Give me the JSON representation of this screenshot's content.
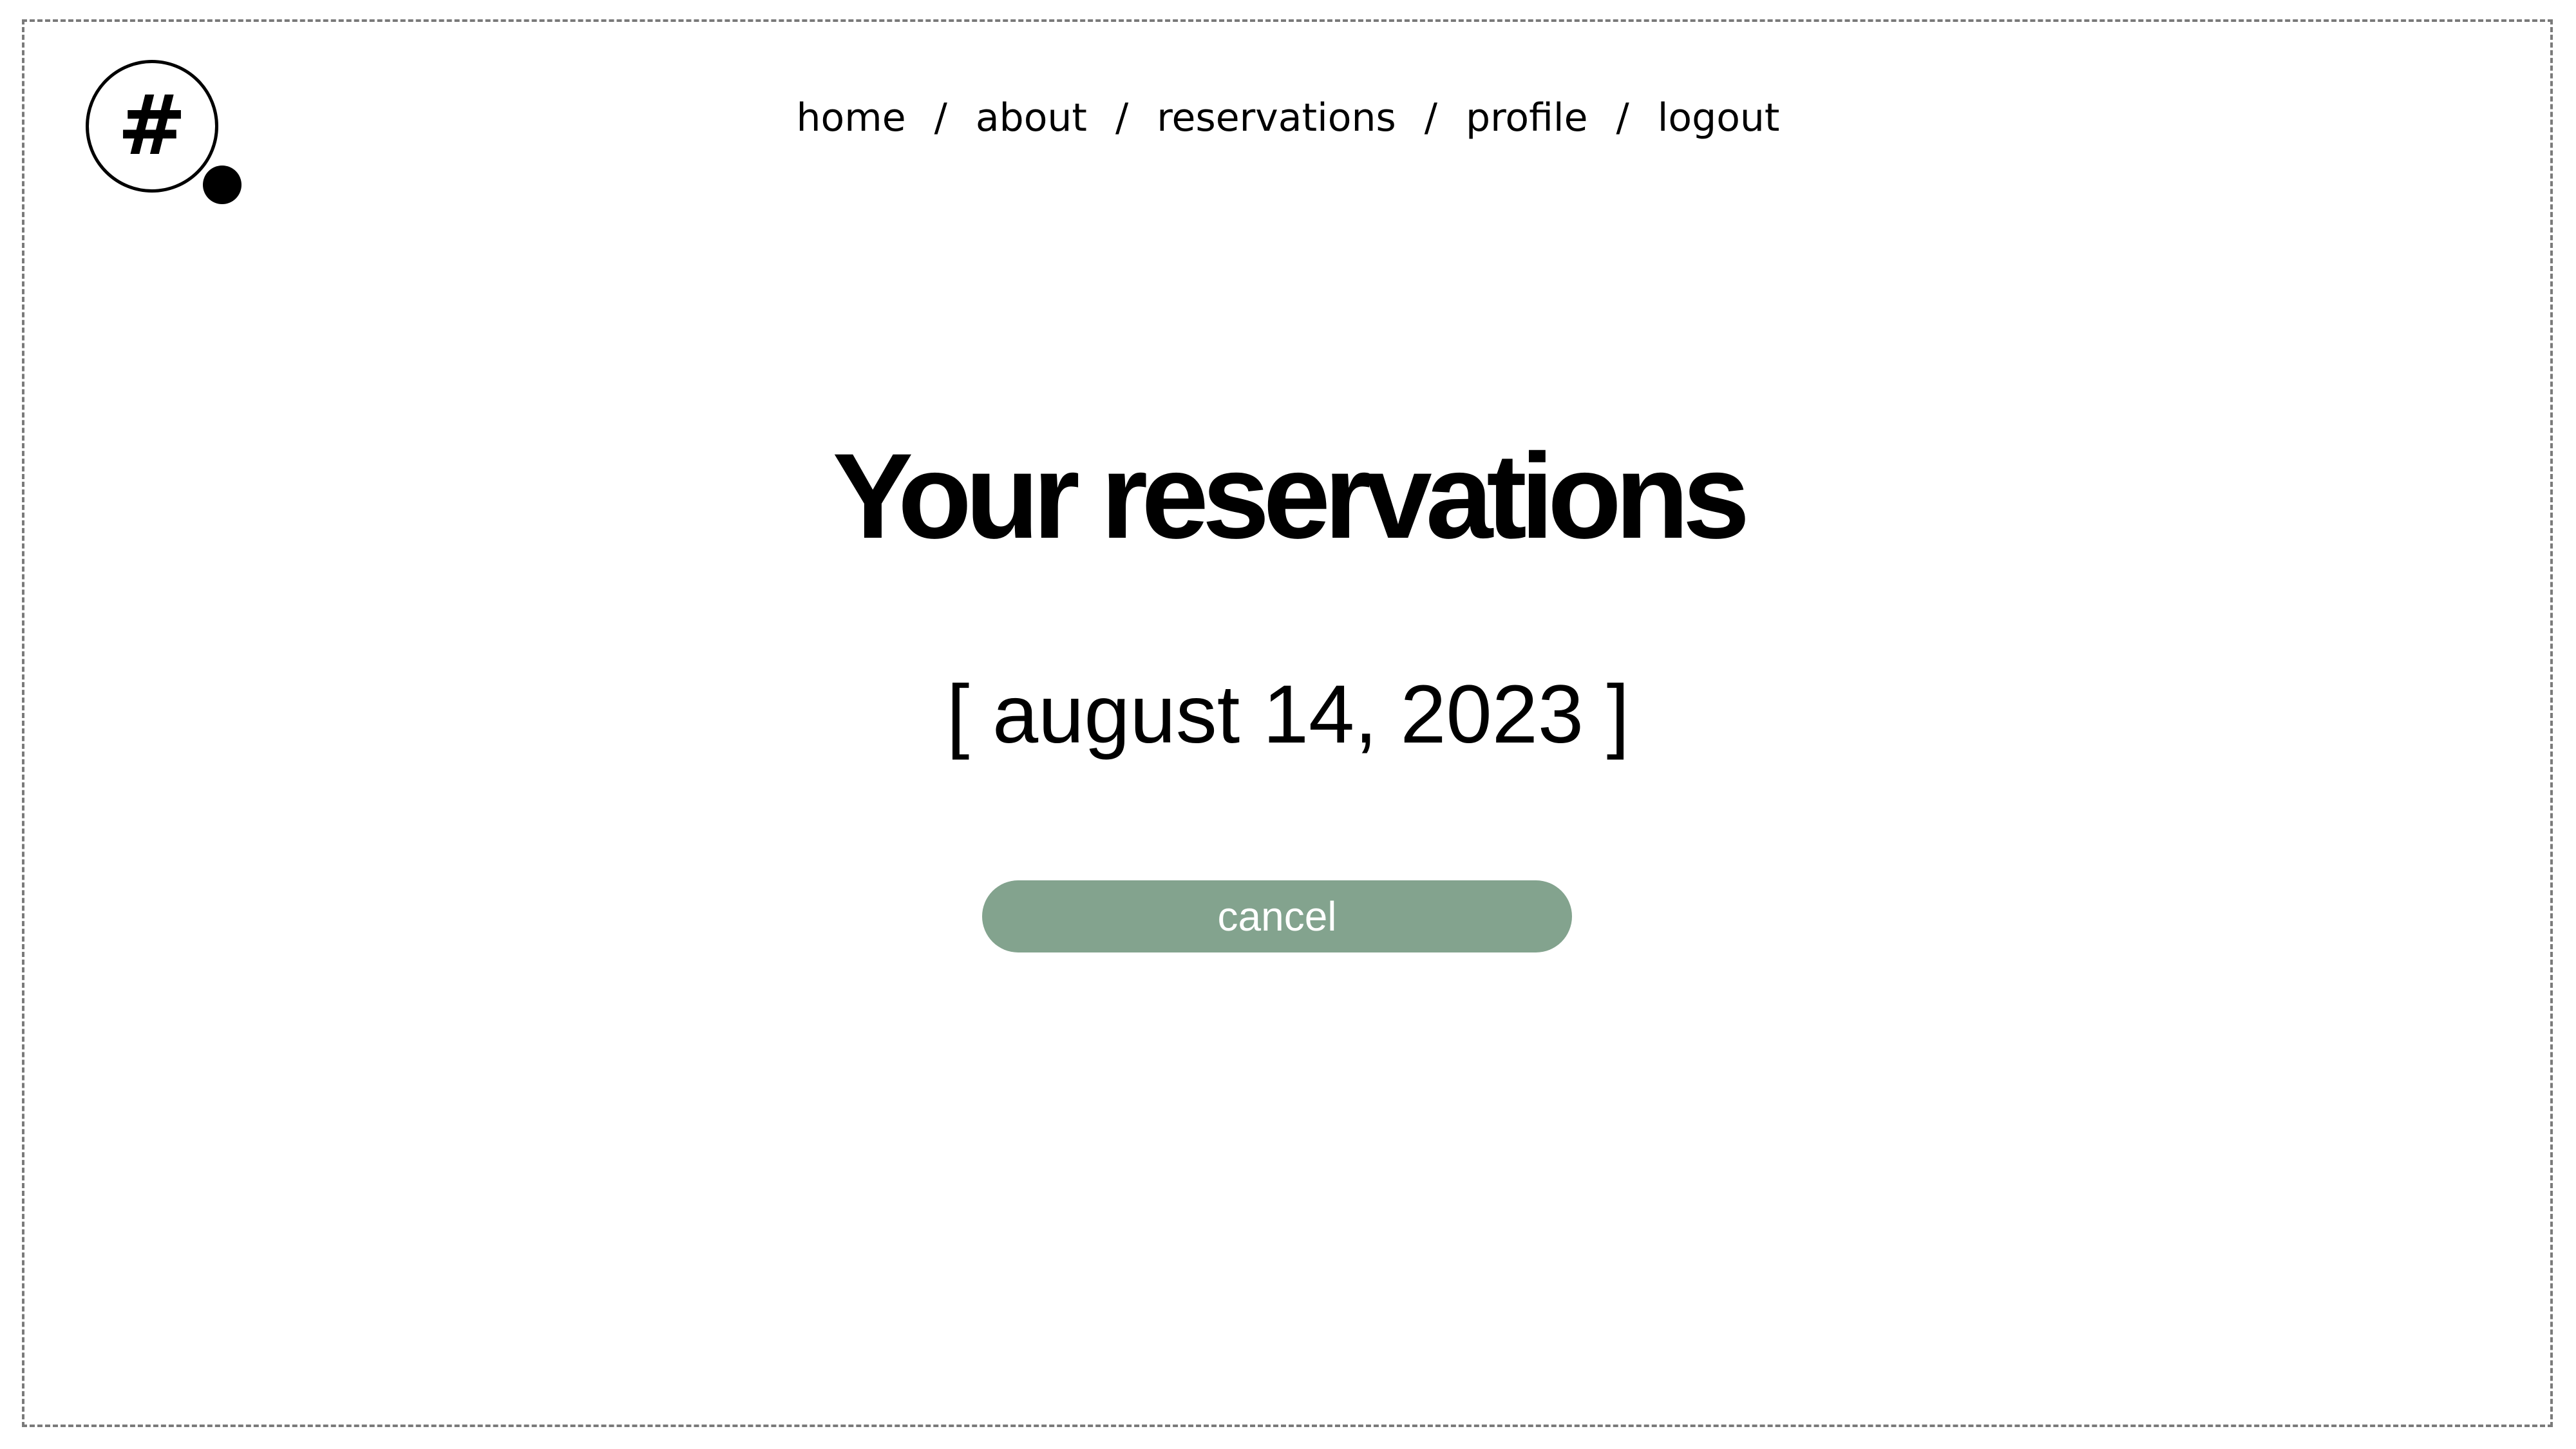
{
  "logo": {
    "glyph": "#"
  },
  "nav": {
    "items": [
      {
        "label": "home"
      },
      {
        "label": "about"
      },
      {
        "label": "reservations"
      },
      {
        "label": "profile"
      },
      {
        "label": "logout"
      }
    ],
    "separator": "/"
  },
  "main": {
    "title": "Your reservations",
    "date": "[ august 14, 2023 ]",
    "cancel_label": "cancel"
  },
  "colors": {
    "accent": "#83a38e",
    "text": "#000000",
    "background": "#ffffff",
    "frame_border": "#7a7a7a"
  },
  "icons": {
    "logo": "hash-icon"
  }
}
